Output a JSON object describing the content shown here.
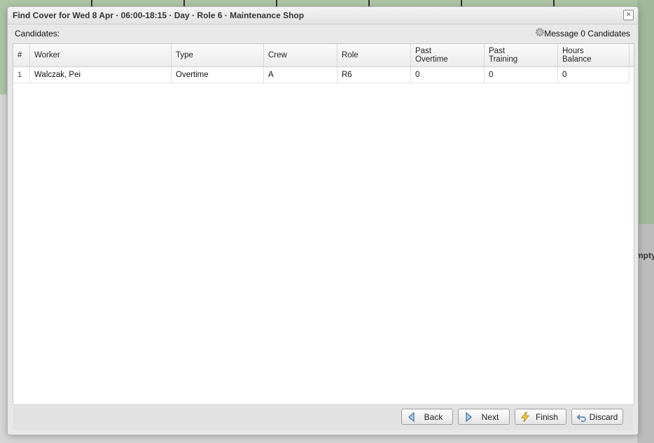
{
  "background": {
    "peek_label": "Empty"
  },
  "dialog": {
    "title": "Find Cover for Wed 8 Apr · 06:00-18:15 · Day · Role 6 · Maintenance Shop",
    "close_symbol": "×",
    "candidates_label": "Candidates:",
    "settings_icon": "gear-icon",
    "message_label": "Message 0 Candidates",
    "table": {
      "headers": [
        "#",
        "Worker",
        "Type",
        "Crew",
        "Role",
        "Past\nOvertime",
        "Past\nTraining",
        "Hours\nBalance"
      ],
      "rows": [
        [
          "1",
          "Walczak, Pei",
          "Overtime",
          "A",
          "R6",
          "0",
          "0",
          "0"
        ]
      ]
    },
    "buttons": {
      "back": "Back",
      "next": "Next",
      "finish": "Finish",
      "discard": "Discard"
    }
  }
}
